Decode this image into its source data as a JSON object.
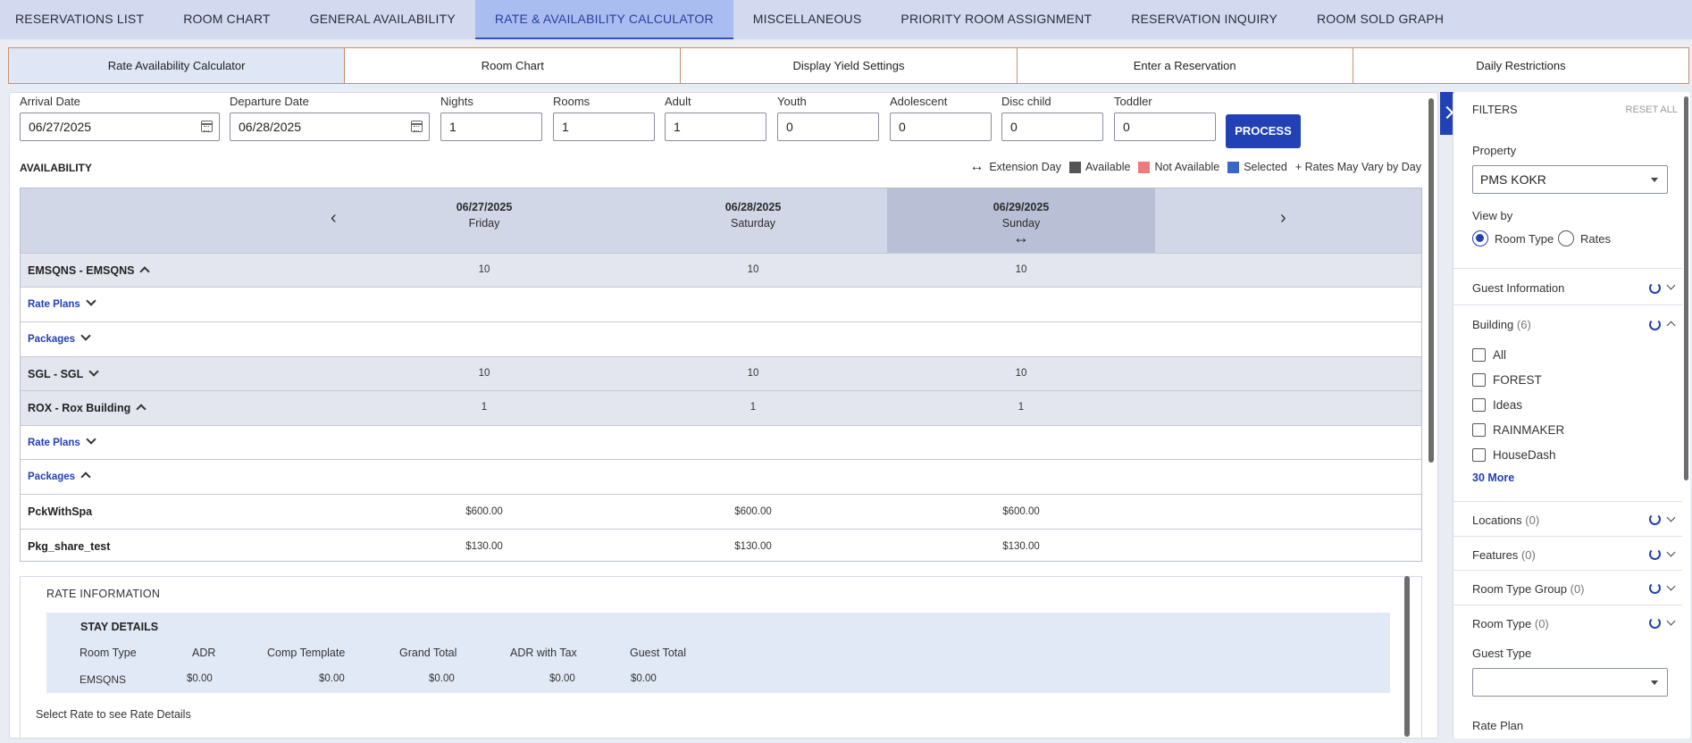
{
  "top_nav": [
    "RESERVATIONS LIST",
    "ROOM CHART",
    "GENERAL AVAILABILITY",
    "RATE & AVAILABILITY CALCULATOR",
    "MISCELLANEOUS",
    "PRIORITY ROOM ASSIGNMENT",
    "RESERVATION INQUIRY",
    "ROOM SOLD GRAPH"
  ],
  "top_nav_active": "RATE & AVAILABILITY CALCULATOR",
  "sub_tabs": [
    "Rate Availability Calculator",
    "Room Chart",
    "Display Yield Settings",
    "Enter a Reservation",
    "Daily Restrictions"
  ],
  "form": {
    "arrival_label": "Arrival Date",
    "arrival_value": "06/27/2025",
    "departure_label": "Departure Date",
    "departure_value": "06/28/2025",
    "nights_label": "Nights",
    "nights_value": "1",
    "rooms_label": "Rooms",
    "rooms_value": "1",
    "adult_label": "Adult",
    "adult_value": "1",
    "youth_label": "Youth",
    "youth_value": "0",
    "adolescent_label": "Adolescent",
    "adolescent_value": "0",
    "disc_child_label": "Disc child",
    "disc_child_value": "0",
    "toddler_label": "Toddler",
    "toddler_value": "0",
    "process_label": "PROCESS"
  },
  "availability": {
    "title": "AVAILABILITY",
    "legend": {
      "extension_day": "Extension Day",
      "available": "Available",
      "not_available": "Not Available",
      "selected": "Selected",
      "rates_vary": "+ Rates May Vary by Day",
      "colors": {
        "available": "#555555",
        "not_available": "#ee7b7b",
        "selected": "#3a66c7"
      }
    },
    "dates": [
      {
        "date": "06/27/2025",
        "day": "Friday"
      },
      {
        "date": "06/28/2025",
        "day": "Saturday"
      },
      {
        "date": "06/29/2025",
        "day": "Sunday"
      }
    ],
    "rows": [
      {
        "label": "EMSQNS - EMSQNS",
        "values": [
          "10",
          "10",
          "10"
        ]
      },
      {
        "label": "Rate Plans",
        "values": []
      },
      {
        "label": "Packages",
        "values": []
      },
      {
        "label": "SGL - SGL",
        "values": [
          "10",
          "10",
          "10"
        ]
      },
      {
        "label": "ROX - Rox Building",
        "values": [
          "1",
          "1",
          "1"
        ]
      },
      {
        "label": "Rate Plans",
        "values": []
      },
      {
        "label": "Packages",
        "values": []
      },
      {
        "label": "PckWithSpa",
        "values": [
          "$600.00",
          "$600.00",
          "$600.00"
        ]
      },
      {
        "label": "Pkg_share_test",
        "values": [
          "$130.00",
          "$130.00",
          "$130.00"
        ]
      }
    ]
  },
  "rate_info": {
    "title": "RATE INFORMATION",
    "stay_details": "STAY DETAILS",
    "columns": [
      "Room Type",
      "ADR",
      "Comp Template",
      "Grand Total",
      "ADR with Tax",
      "Guest Total"
    ],
    "row": [
      "EMSQNS",
      "$0.00",
      "$0.00",
      "$0.00",
      "$0.00",
      "$0.00"
    ],
    "hint": "Select Rate to see Rate Details"
  },
  "filters": {
    "title": "FILTERS",
    "reset": "RESET ALL",
    "property_label": "Property",
    "property_value": "PMS KOKR",
    "view_by_label": "View by",
    "view_options": [
      "Room Type",
      "Rates"
    ],
    "view_selected": "Room Type",
    "guest_info": "Guest Information",
    "building": {
      "label": "Building",
      "count": "(6)"
    },
    "building_items": [
      "All",
      "FOREST",
      "Ideas",
      "RAINMAKER",
      "HouseDash"
    ],
    "more": "30 More",
    "locations": {
      "label": "Locations",
      "count": "(0)"
    },
    "features": {
      "label": "Features",
      "count": "(0)"
    },
    "room_type_group": {
      "label": "Room Type Group",
      "count": "(0)"
    },
    "room_type": {
      "label": "Room Type",
      "count": "(0)"
    },
    "guest_type_label": "Guest Type",
    "rate_plan_label": "Rate Plan"
  }
}
